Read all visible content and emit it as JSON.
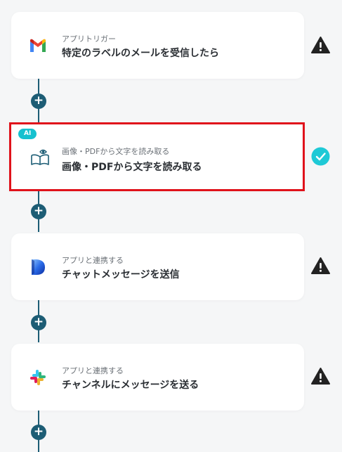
{
  "flow": {
    "steps": [
      {
        "sub_label": "アプリトリガー",
        "title": "特定のラベルのメールを受信したら",
        "app_icon": "gmail-icon",
        "status": "warning"
      },
      {
        "badge": "AI",
        "sub_label": "画像・PDFから文字を読み取る",
        "title": "画像・PDFから文字を読み取る",
        "app_icon": "ocr-book-eye-icon",
        "status": "complete",
        "selected": true
      },
      {
        "sub_label": "アプリと連携する",
        "title": "チャットメッセージを送信",
        "app_icon": "app-d-logo-icon",
        "status": "warning"
      },
      {
        "sub_label": "アプリと連携する",
        "title": "チャンネルにメッセージを送る",
        "app_icon": "slack-icon",
        "status": "warning"
      }
    ],
    "add_step_symbol": "+"
  },
  "colors": {
    "connector": "#1d5d75",
    "selection_border": "#e0121b",
    "ai_badge": "#16c1cf",
    "check": "#1ec9d6",
    "warning": "#222222"
  }
}
